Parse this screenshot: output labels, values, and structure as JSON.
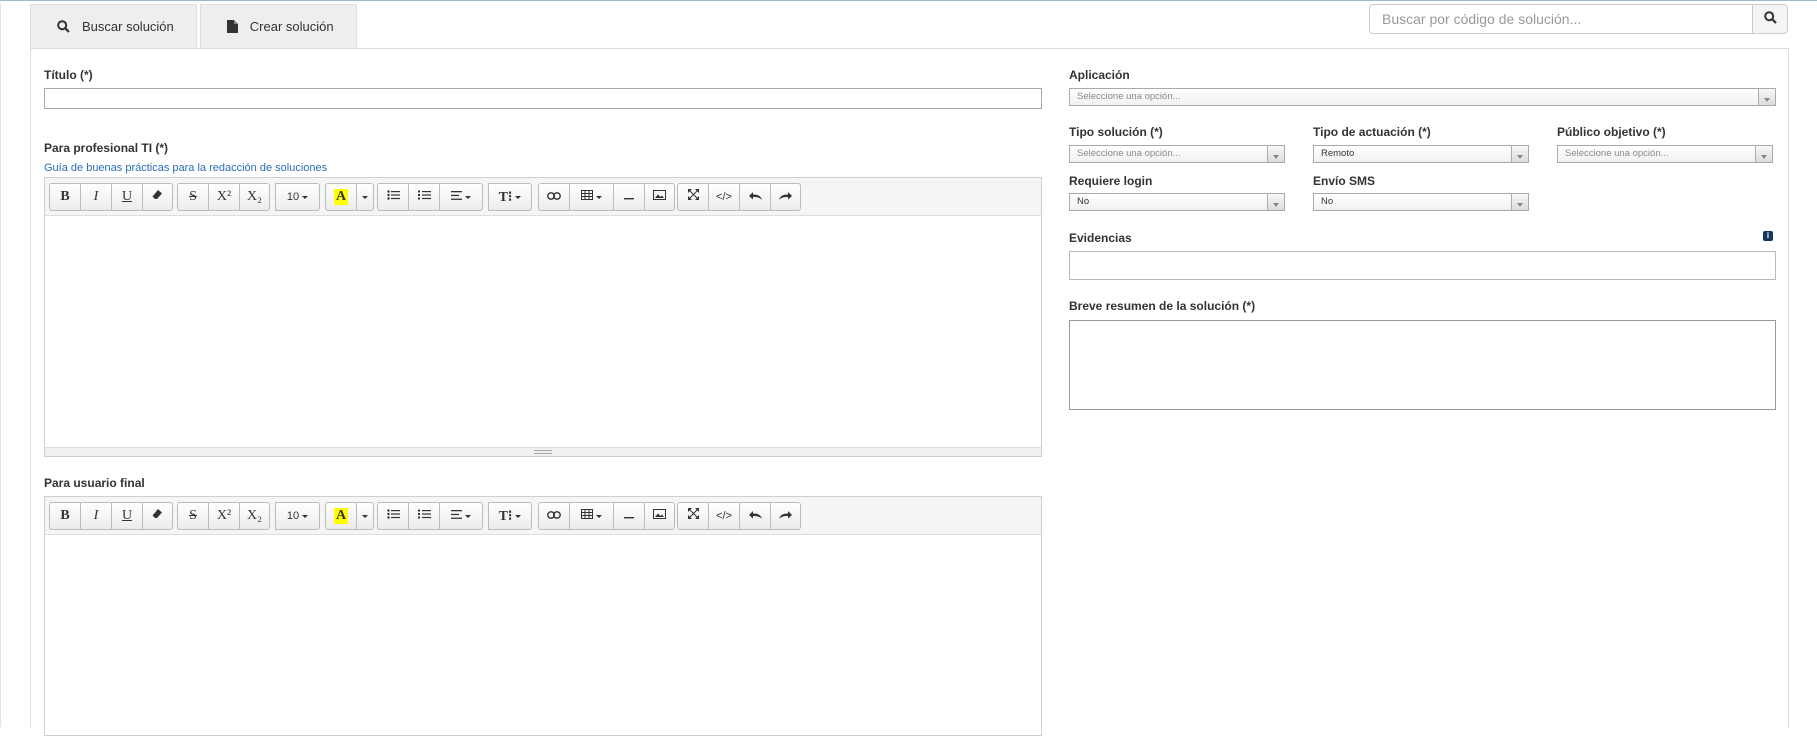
{
  "tabs": [
    {
      "label": "Buscar solución",
      "icon": "search-icon"
    },
    {
      "label": "Crear solución",
      "icon": "file-icon"
    }
  ],
  "search": {
    "placeholder": "Buscar por código de solución..."
  },
  "form": {
    "titulo_label": "Título (*)",
    "profesional_label": "Para profesional TI (*)",
    "guia_link": "Guía de buenas prácticas para la redacción de soluciones",
    "usuario_final_label": "Para usuario final",
    "aplicacion": {
      "label": "Aplicación",
      "value": "Seleccione una opción..."
    },
    "tipo_solucion": {
      "label": "Tipo solución (*)",
      "value": "Seleccione una opción..."
    },
    "tipo_actuacion": {
      "label": "Tipo de actuación (*)",
      "value": "Remoto"
    },
    "publico_objetivo": {
      "label": "Público objetivo (*)",
      "value": "Seleccione una opción..."
    },
    "requiere_login": {
      "label": "Requiere login",
      "value": "No"
    },
    "envio_sms": {
      "label": "Envío SMS",
      "value": "No"
    },
    "evidencias_label": "Evidencias",
    "resumen_label": "Breve resumen de la solución (*)"
  },
  "toolbar": {
    "bold": "B",
    "italic": "I",
    "underline": "U",
    "strike": "S",
    "superscript": "X²",
    "subscript": "X₂",
    "font_size": "10",
    "highlight": "A",
    "font_family": "T⁝"
  }
}
